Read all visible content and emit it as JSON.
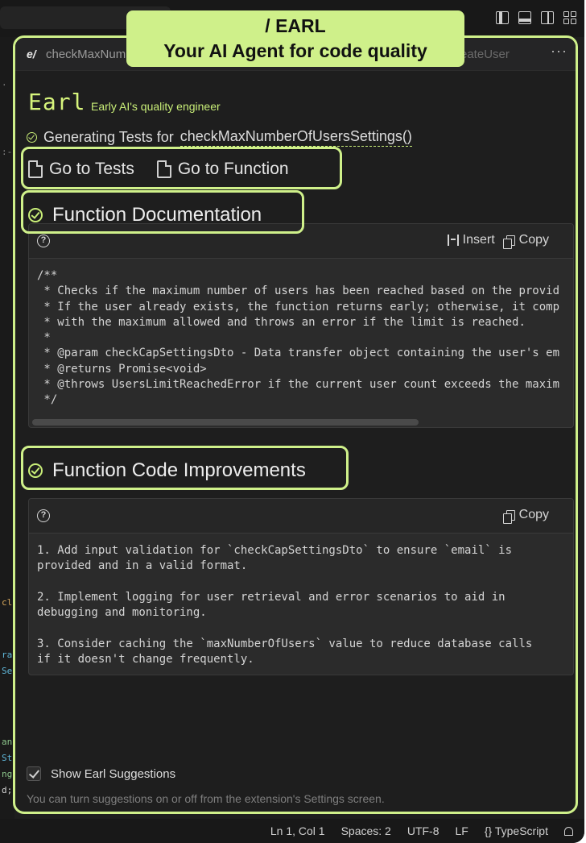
{
  "badge": {
    "line1": "/ EARL",
    "line2": "Your AI Agent for code quality"
  },
  "editor_tabs": {
    "logo": "e/",
    "active_tab": "checkMaxNum",
    "other_tab": "reateUser",
    "more": "···"
  },
  "earl": {
    "title": "Earl",
    "subtitle": "Early AI's quality engineer"
  },
  "generating": {
    "prefix": "Generating Tests for",
    "function": "checkMaxNumberOfUsersSettings()"
  },
  "nav": {
    "tests": "Go to Tests",
    "function": "Go to Function"
  },
  "documentation": {
    "heading": "Function Documentation",
    "insert_label": "Insert",
    "copy_label": "Copy",
    "code": "/**\n * Checks if the maximum number of users has been reached based on the provid\n * If the user already exists, the function returns early; otherwise, it comp\n * with the maximum allowed and throws an error if the limit is reached.\n *\n * @param checkCapSettingsDto - Data transfer object containing the user's em\n * @returns Promise<void>\n * @throws UsersLimitReachedError if the current user count exceeds the maxim\n */"
  },
  "improvements": {
    "heading": "Function Code Improvements",
    "copy_label": "Copy",
    "code": "1. Add input validation for `checkCapSettingsDto` to ensure `email` is\nprovided and in a valid format.\n\n2. Implement logging for user retrieval and error scenarios to aid in\ndebugging and monitoring.\n\n3. Consider caching the `maxNumberOfUsers` value to reduce database calls\nif it doesn't change frequently."
  },
  "suggestions": {
    "checkbox_label": "Show Earl Suggestions",
    "checked": true,
    "hint": "You can turn suggestions on or off from the extension's Settings screen."
  },
  "status_bar": {
    "position": "Ln 1, Col 1",
    "spaces": "Spaces: 2",
    "encoding": "UTF-8",
    "eol": "LF",
    "language": "{} TypeScript"
  },
  "colors": {
    "accent": "#cff08a",
    "earl_green": "#d7f57c",
    "background": "#1e1e1e"
  },
  "icons": [
    "split-editor-icon",
    "toggle-panel-icon",
    "toggle-sidebar-icon",
    "customize-layout-icon",
    "go-to-tests-icon",
    "go-to-function-icon",
    "check-circle-icon",
    "help-icon",
    "insert-icon",
    "copy-icon",
    "bell-icon"
  ]
}
